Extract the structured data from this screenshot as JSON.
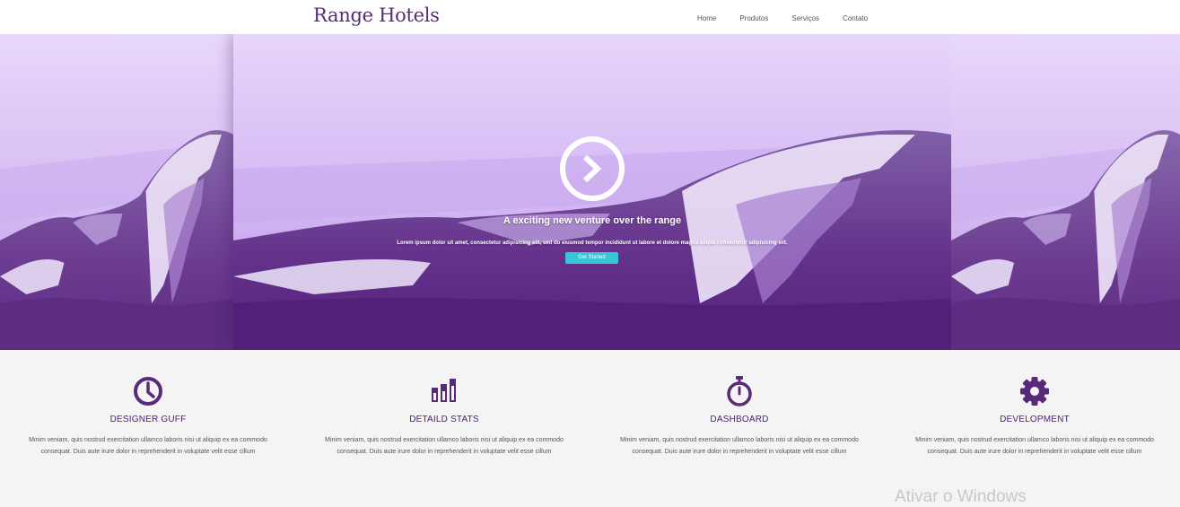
{
  "brand": {
    "name": "Range Hotels"
  },
  "nav": {
    "items": [
      "Home",
      "Produtos",
      "Serviços",
      "Contato"
    ]
  },
  "hero": {
    "title": "A exciting new venture over the range",
    "subtitle": "Lorem ipsum dolor sit amet, consectetur adipisicing elit, sed do eiusmod tempor incididunt ut labore et dolore magna aliqua consectetur adipisicing elit.",
    "cta_label": "Get Started",
    "play_icon": "chevron-right-circle-icon"
  },
  "features": [
    {
      "icon": "clock-icon",
      "title": "DESIGNER GUFF",
      "text": "Minim veniam, quis nostrud exercitation ullamco laboris nisi ut aliquip ex ea commodo consequat. Duis aute irure dolor in reprehenderit in voluptate velit esse cillum"
    },
    {
      "icon": "bar-chart-icon",
      "title": "DETAILD STATS",
      "text": "Minim veniam, quis nostrud exercitation ullamco laboris nisi ut aliquip ex ea commodo consequat. Duis aute irure dolor in reprehenderit in voluptate velit esse cillum"
    },
    {
      "icon": "stopwatch-icon",
      "title": "DASHBOARD",
      "text": "Minim veniam, quis nostrud exercitation ullamco laboris nisi ut aliquip ex ea commodo consequat. Duis aute irure dolor in reprehenderit in voluptate velit esse cillum"
    },
    {
      "icon": "gear-icon",
      "title": "DEVELOPMENT",
      "text": "Minim veniam, quis nostrud exercitation ullamco laboris nisi ut aliquip ex ea commodo consequat. Duis aute irure dolor in reprehenderit in voluptate velit esse cillum"
    }
  ],
  "watermark": {
    "text": "Ativar o Windows"
  },
  "colors": {
    "brand": "#5a2a7a",
    "accent": "#38c6d6",
    "hero_dark": "#5c2682",
    "hero_light": "#e6d4fa"
  }
}
